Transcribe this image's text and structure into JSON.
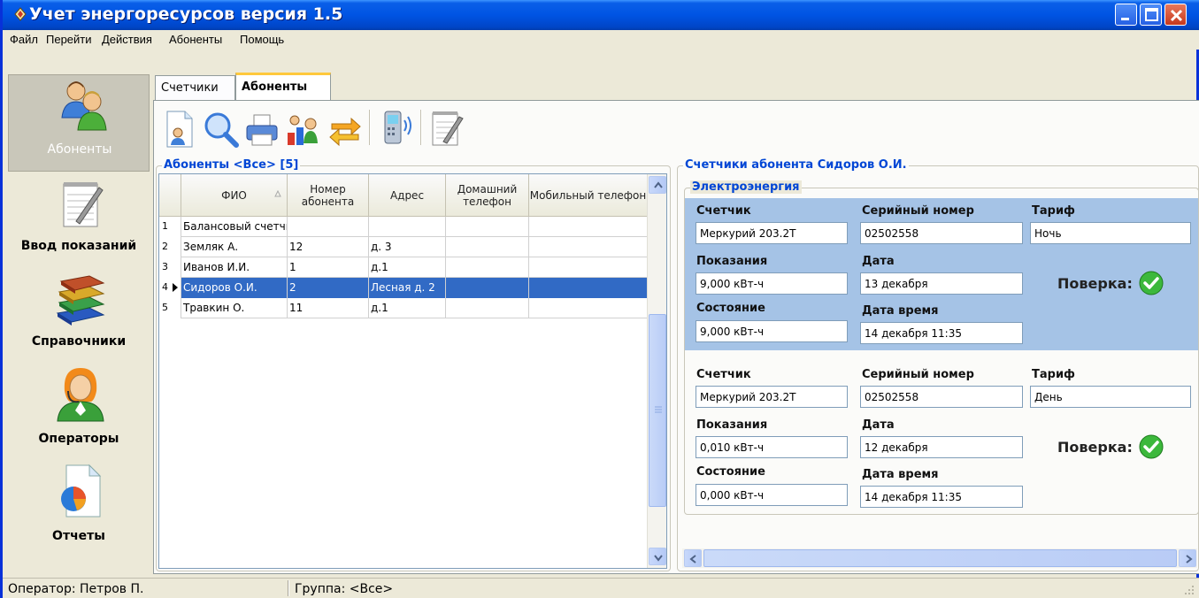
{
  "window": {
    "title": "Учет энергоресурсов версия 1.5"
  },
  "menu": [
    "Файл",
    "Перейти",
    "Действия",
    "Абоненты",
    "Помощь"
  ],
  "nav": [
    {
      "label": "Абоненты",
      "icon": "subscribers-icon",
      "active": true
    },
    {
      "label": "Ввод показаний",
      "icon": "notepad-icon",
      "active": false
    },
    {
      "label": "Справочники",
      "icon": "books-icon",
      "active": false
    },
    {
      "label": "Операторы",
      "icon": "operator-icon",
      "active": false
    },
    {
      "label": "Отчеты",
      "icon": "report-icon",
      "active": false
    }
  ],
  "tabs": [
    {
      "label": "Счетчики",
      "active": false
    },
    {
      "label": "Абоненты",
      "active": true
    }
  ],
  "toolbar": [
    "new-subscriber-icon",
    "search-icon",
    "print-icon",
    "group-icon",
    "refresh-icon",
    "phone-icon",
    "notepad-icon"
  ],
  "subscribers": {
    "title": "Абоненты <Все> [5]",
    "columns": [
      "ФИО",
      "Номер абонента",
      "Адрес",
      "Домашний телефон",
      "Мобильный телефон"
    ],
    "rows": [
      {
        "n": "1",
        "fio": "Балансовый счетчик",
        "num": "",
        "addr": "",
        "home": "",
        "mobile": "",
        "selected": false
      },
      {
        "n": "2",
        "fio": "Земляк А.",
        "num": "12",
        "addr": "д. 3",
        "home": "",
        "mobile": "",
        "selected": false
      },
      {
        "n": "3",
        "fio": "Иванов И.И.",
        "num": "1",
        "addr": "д.1",
        "home": "",
        "mobile": "",
        "selected": false
      },
      {
        "n": "4",
        "fio": "Сидоров О.И.",
        "num": "2",
        "addr": "Лесная д. 2",
        "home": "",
        "mobile": "",
        "selected": true
      },
      {
        "n": "5",
        "fio": "Травкин О.",
        "num": "11",
        "addr": "д.1",
        "home": "",
        "mobile": "",
        "selected": false
      }
    ]
  },
  "meters": {
    "title": "Счетчики абонента Сидоров О.И.",
    "group": "Электроэнергия",
    "labels": {
      "meter": "Счетчик",
      "serial": "Серийный номер",
      "tariff": "Тариф",
      "readings": "Показания",
      "date": "Дата",
      "state": "Состояние",
      "datetime": "Дата время",
      "verify": "Поверка:"
    },
    "items": [
      {
        "meter": "Меркурий 203.2Т",
        "serial": "02502558",
        "tariff": "Ночь",
        "readings": "9,000 кВт-ч",
        "date": "13 декабря",
        "state": "9,000 кВт-ч",
        "datetime": "14 декабря 11:35"
      },
      {
        "meter": "Меркурий 203.2Т",
        "serial": "02502558",
        "tariff": "День",
        "readings": "0,010 кВт-ч",
        "date": "12 декабря",
        "state": "0,000 кВт-ч",
        "datetime": "14 декабря 11:35"
      }
    ]
  },
  "status": {
    "operator": "Оператор: Петров П.",
    "group": "Группа: <Все>"
  },
  "colors": {
    "selection": "#316ac5",
    "highlight_block": "#a5c3e6",
    "title_blue": "#0046d5",
    "verify_ok": "#3cb83c"
  }
}
